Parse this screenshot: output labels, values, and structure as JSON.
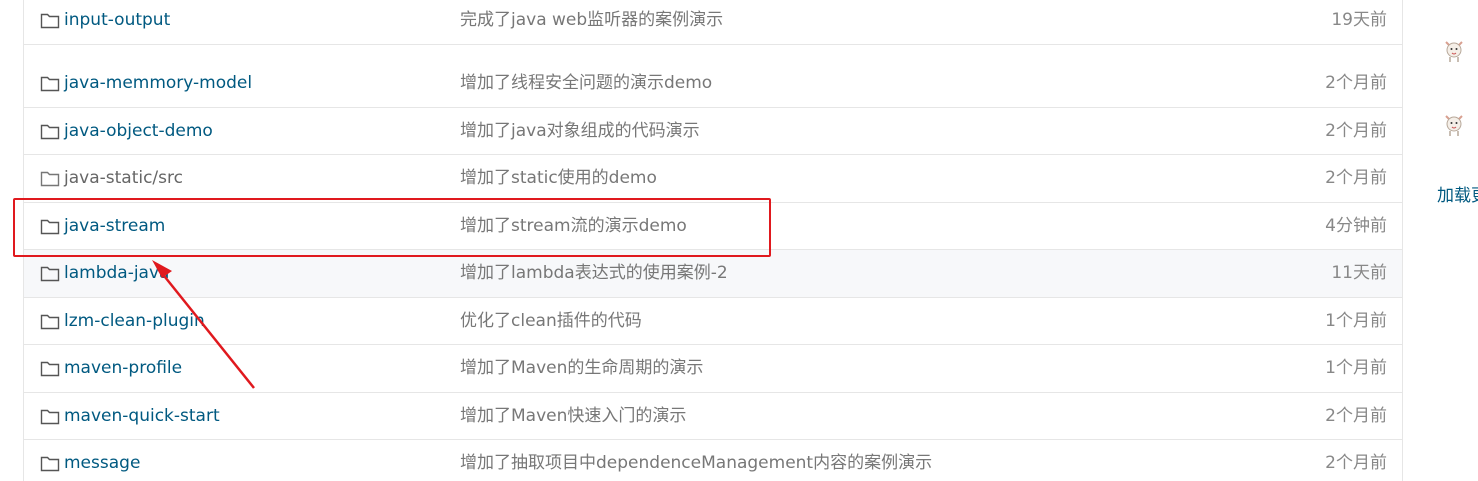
{
  "rows": [
    {
      "name": "input-output",
      "message": "完成了java web监听器的案例演示",
      "time": "19天前"
    },
    {
      "name": "java-memmory-model",
      "message": "增加了线程安全问题的演示demo",
      "time": "2个月前"
    },
    {
      "name": "java-object-demo",
      "message": "增加了java对象组成的代码演示",
      "time": "2个月前"
    },
    {
      "name": "java-static/src",
      "message": "增加了static使用的demo",
      "time": "2个月前"
    },
    {
      "name": "java-stream",
      "message": "增加了stream流的演示demo",
      "time": "4分钟前"
    },
    {
      "name": "lambda-java",
      "message": "增加了lambda表达式的使用案例-2",
      "time": "11天前"
    },
    {
      "name": "lzm-clean-plugin",
      "message": "优化了clean插件的代码",
      "time": "1个月前"
    },
    {
      "name": "maven-profile",
      "message": "增加了Maven的生命周期的演示",
      "time": "1个月前"
    },
    {
      "name": "maven-quick-start",
      "message": "增加了Maven快速入门的演示",
      "time": "2个月前"
    },
    {
      "name": "message",
      "message": "增加了抽取项目中dependenceManagement内容的案例演示",
      "time": "2个月前"
    }
  ],
  "sidebar": {
    "load_more_label": "加载更多"
  },
  "colors": {
    "link": "#005980",
    "annotation": "#e0191e"
  }
}
